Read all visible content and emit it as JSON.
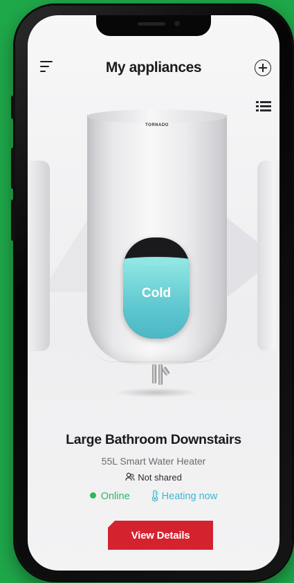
{
  "header": {
    "title": "My appliances",
    "menu_icon": "hamburger-menu-icon",
    "add_icon": "plus-circle-icon",
    "list_icon": "list-view-icon"
  },
  "appliance": {
    "brand": "TORNADO",
    "display_status": "Cold",
    "name": "Large Bathroom Downstairs",
    "model": "55L Smart Water Heater",
    "share_status": "Not shared",
    "connection_status": "Online",
    "heating_status": "Heating now"
  },
  "actions": {
    "view_details_label": "View Details"
  },
  "colors": {
    "background": "#1fa84a",
    "accent_red": "#d5222f",
    "online_green": "#2eb85c",
    "heating_blue": "#3bb6d2",
    "water_cyan": "#5ec7cf"
  }
}
